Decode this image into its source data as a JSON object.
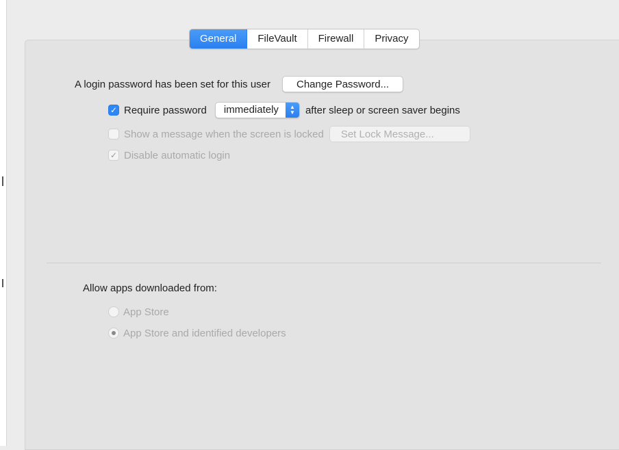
{
  "tabs": [
    {
      "label": "General",
      "active": true
    },
    {
      "label": "FileVault",
      "active": false
    },
    {
      "label": "Firewall",
      "active": false
    },
    {
      "label": "Privacy",
      "active": false
    }
  ],
  "general": {
    "login_password_text": "A login password has been set for this user",
    "change_password_label": "Change Password...",
    "require_password": {
      "checked": true,
      "label": "Require password",
      "select_value": "immediately",
      "suffix": "after sleep or screen saver begins"
    },
    "show_message": {
      "checked": false,
      "enabled": false,
      "label": "Show a message when the screen is locked",
      "button_label": "Set Lock Message..."
    },
    "disable_auto_login": {
      "checked": true,
      "enabled": false,
      "label": "Disable automatic login"
    }
  },
  "allow_apps": {
    "heading": "Allow apps downloaded from:",
    "options": [
      {
        "label": "App Store",
        "selected": false,
        "enabled": false
      },
      {
        "label": "App Store and identified developers",
        "selected": true,
        "enabled": false
      }
    ]
  },
  "colors": {
    "accent": "#2f86f5",
    "panel_bg": "#e3e3e3",
    "window_bg": "#ececec"
  }
}
